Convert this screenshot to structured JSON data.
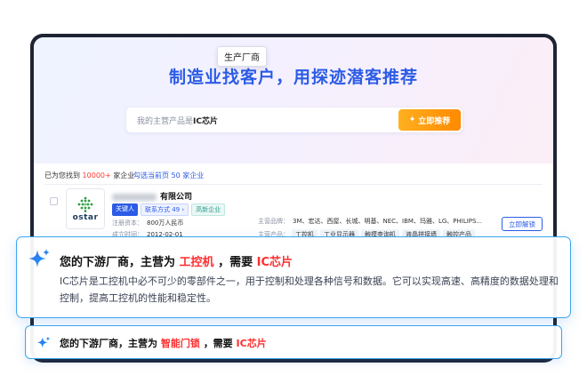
{
  "hero": {
    "title": "制造业找客户，用探迹潜客推荐",
    "search_prefix": "我的主营产品是",
    "search_keyword": "IC芯片",
    "recommend_button": "立即推荐"
  },
  "stats": {
    "found_prefix": "已为您找到",
    "found_count": "10000+",
    "found_suffix": "家企业",
    "select_link": "勾选当前页 50 家企业"
  },
  "company": {
    "name_visible": "有限公司",
    "logo_text": "ostar",
    "tags": [
      "关键人",
      "联系方式 49 ›",
      "高新企业"
    ],
    "tooltip": "生产厂商",
    "capital_label": "注册资本：",
    "capital_value": "800万人民币",
    "founded_label": "成立时间：",
    "founded_value": "2012-02-01",
    "brands_label": "主营品牌：",
    "brands_value": "3M、宏达、西屋、长城、明基、NEC、IBM、玛雅、LG、PHILIPS...",
    "products_label": "主营产品：",
    "products": [
      "工控机",
      "工业显示器",
      "触摸查询机",
      "液晶拼接墙",
      "触控产品"
    ],
    "unlock_button": "立即解锁"
  },
  "callout_main": {
    "head_prefix": "您的下游厂商，主营为",
    "head_product": "工控机",
    "head_mid": "，需要",
    "head_need": "IC芯片",
    "description": "IC芯片是工控机中必不可少的零部件之一，用于控制和处理各种信号和数据。它可以实现高速、高精度的数据处理和控制，提高工控机的性能和稳定性。"
  },
  "callout_second": {
    "head_prefix": "您的下游厂商，主营为",
    "head_product": "智能门锁",
    "head_mid": "，需要",
    "head_need": "IC芯片"
  },
  "colors": {
    "brand_blue": "#2c5ce6",
    "highlight_red": "#ff2d2d",
    "cta_orange": "#ff8a00",
    "callout_border": "#3aa7f0"
  }
}
